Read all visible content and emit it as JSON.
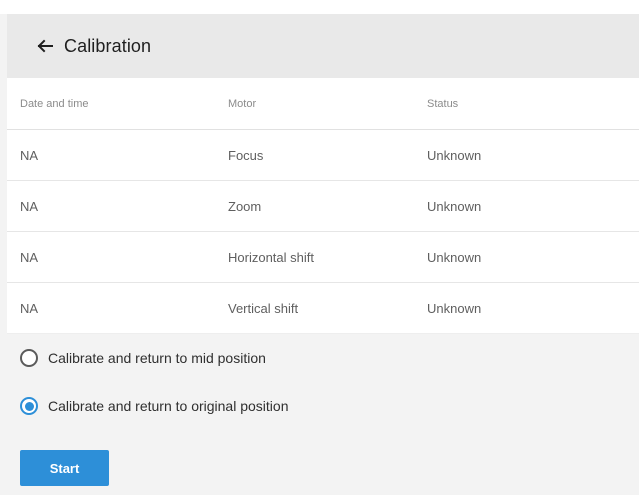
{
  "header": {
    "title": "Calibration"
  },
  "table": {
    "columns": [
      "Date and time",
      "Motor",
      "Status"
    ],
    "rows": [
      {
        "date": "NA",
        "motor": "Focus",
        "status": "Unknown"
      },
      {
        "date": "NA",
        "motor": "Zoom",
        "status": "Unknown"
      },
      {
        "date": "NA",
        "motor": "Horizontal shift",
        "status": "Unknown"
      },
      {
        "date": "NA",
        "motor": "Vertical shift",
        "status": "Unknown"
      }
    ]
  },
  "options": {
    "mid_label": "Calibrate and return to mid position",
    "original_label": "Calibrate and return to original position",
    "selected": "original"
  },
  "actions": {
    "start_label": "Start"
  },
  "colors": {
    "accent": "#2d8fd8",
    "header_bg": "#e9e9e9",
    "panel_bg": "#f3f3f3"
  },
  "icons": {
    "back": "arrow-left-icon"
  }
}
